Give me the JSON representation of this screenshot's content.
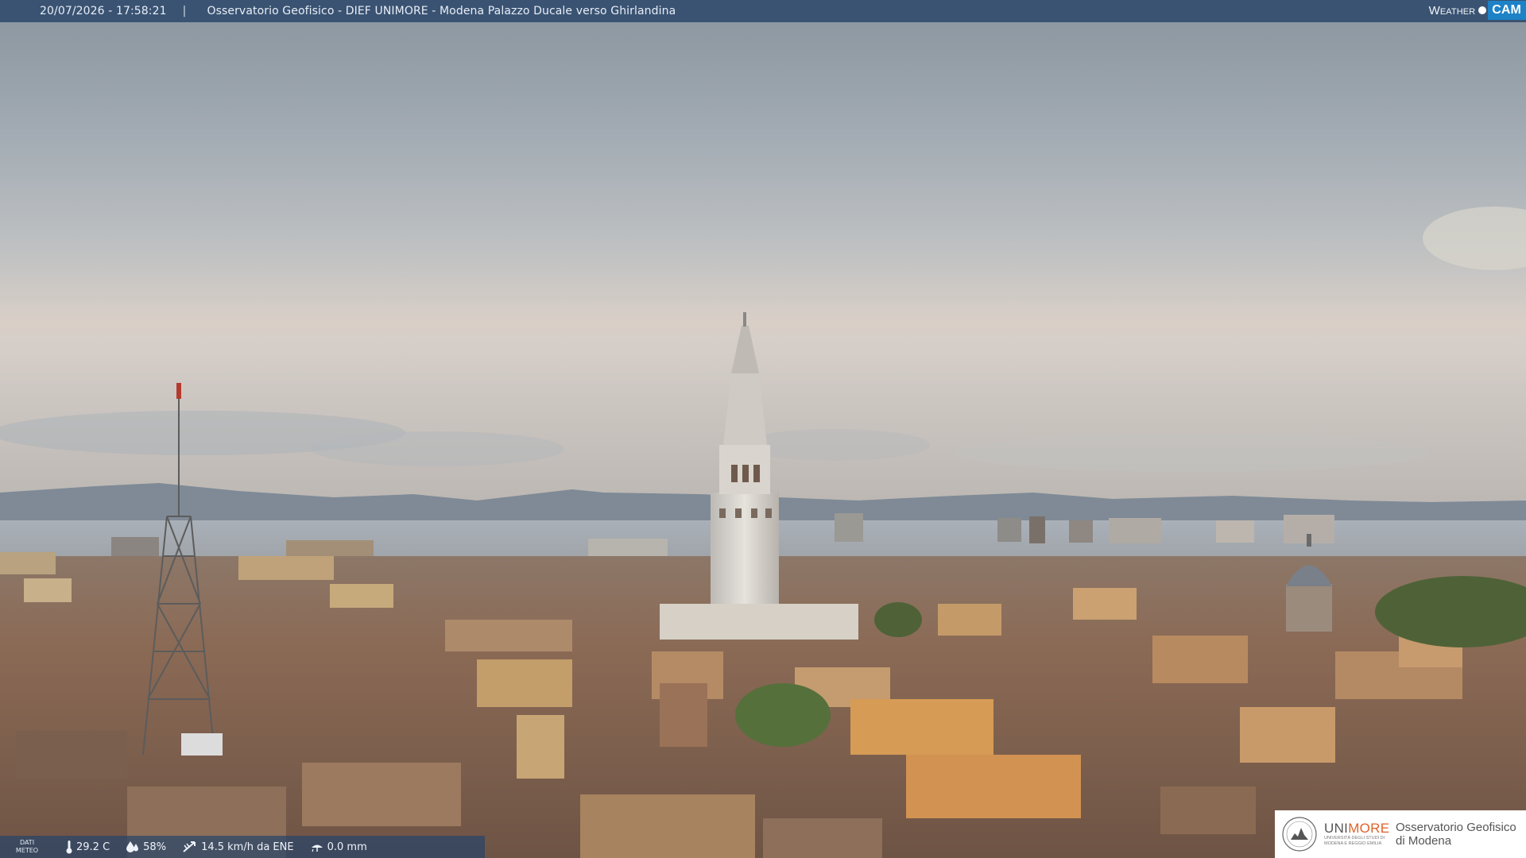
{
  "overlay": {
    "timestamp": "20/07/2026 - 17:58:21",
    "separator": "|",
    "title": "Osservatorio Geofisico - DIEF UNIMORE - Modena Palazzo Ducale verso Ghirlandina"
  },
  "weathercam_logo": {
    "weather": "Weather",
    "cam": "CAM"
  },
  "meteo": {
    "label_line1": "DATI",
    "label_line2": "METEO",
    "temperature": "29.2 C",
    "humidity": "58%",
    "wind": "14.5 km/h da ENE",
    "rain": "0.0 mm"
  },
  "unimore": {
    "name_prefix": "UNI",
    "name_accent": "MORE",
    "subtitle_line1": "UNIVERSITÀ DEGLI STUDI DI",
    "subtitle_line2": "MODENA E REGGIO EMILIA",
    "observatory_line1": "Osservatorio Geofisico",
    "observatory_line2": "di Modena"
  },
  "colors": {
    "overlay_bar": "#284468",
    "unimore_accent": "#e0622a",
    "weathercam_blue": "#1d82c6"
  },
  "icons": {
    "temperature": "thermometer-icon",
    "humidity": "droplet-icon",
    "wind": "wind-icon",
    "rain": "rain-icon"
  }
}
